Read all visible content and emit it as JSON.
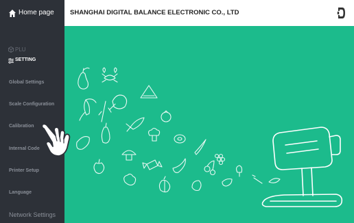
{
  "sidebar": {
    "home_label": "Home page",
    "items": [
      {
        "label": "PLU"
      },
      {
        "label": "SETTING"
      },
      {
        "label": "Global Settings"
      },
      {
        "label": "Scale Configuration"
      },
      {
        "label": "Calibration"
      },
      {
        "label": "Internal Code"
      },
      {
        "label": "Printer Setup"
      },
      {
        "label": "Language"
      },
      {
        "label": "Network Settings"
      }
    ]
  },
  "header": {
    "company": "SHANGHAI DIGITAL BALANCE ELECTRONIC CO., LTD"
  },
  "colors": {
    "sidebar_bg": "#2d3138",
    "main_bg": "#1cbb8c",
    "header_bg": "#ffffff"
  },
  "icons": [
    "home-icon",
    "plu-icon",
    "setting-sliders-icon",
    "company-logo-icon",
    "pointer-hand-icon",
    "scale-illustration"
  ]
}
